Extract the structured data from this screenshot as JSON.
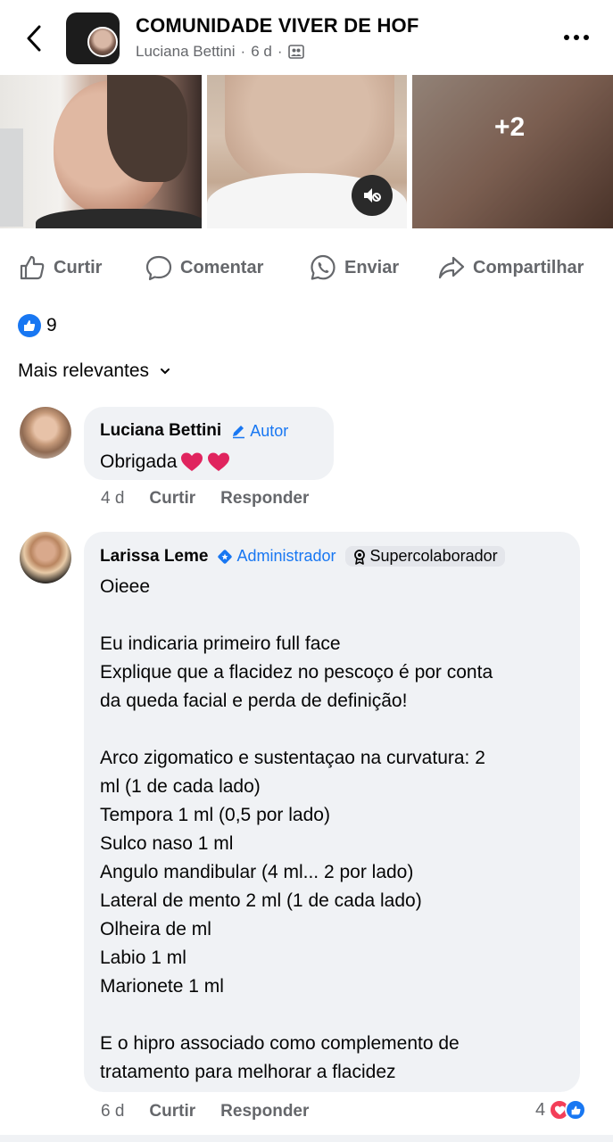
{
  "header": {
    "back_icon": "chevron-left-icon",
    "group_name": "COMUNIDADE VIVER DE HOF",
    "author": "Luciana Bettini",
    "time": "6 d",
    "separator": "·",
    "group_icon": "group-members-icon",
    "more_icon": "more-horizontal-icon"
  },
  "photos": {
    "extra_count": "+2",
    "mute_icon": "mute-icon"
  },
  "actions": {
    "like": "Curtir",
    "comment": "Comentar",
    "send": "Enviar",
    "share": "Compartilhar"
  },
  "reactions": {
    "count": "9",
    "icon": "like-reaction-icon",
    "color": "#1877f2"
  },
  "sort": {
    "label": "Mais relevantes"
  },
  "comments": [
    {
      "name": "Luciana Bettini",
      "role": "Autor",
      "text": "Obrigada",
      "emoji": "❤️❤️",
      "time": "4 d",
      "like": "Curtir",
      "reply": "Responder"
    },
    {
      "name": "Larissa Leme",
      "role": "Administrador",
      "badge": "Supercolaborador",
      "text": "Oieee\n\nEu indicaria primeiro full face\nExplique que a flacidez no pescoço é por conta\nda queda facial e perda de definição!\n\nArco zigomatico e sustentaçao na curvatura: 2\nml (1 de cada lado)\nTempora 1 ml (0,5 por lado)\nSulco naso 1 ml\nAngulo mandibular (4 ml... 2 por lado)\nLateral de mento 2 ml (1 de cada lado)\nOlheira de ml\nLabio 1 ml\nMarionete 1 ml\n\nE o hipro associado como complemento de\ntratamento para melhorar a flacidez",
      "time": "6 d",
      "like": "Curtir",
      "reply": "Responder",
      "reaction_count": "4"
    }
  ],
  "colors": {
    "accent": "#1877f2",
    "love": "#f33e58",
    "secondary_text": "#65676b",
    "bubble": "#f0f2f5"
  }
}
